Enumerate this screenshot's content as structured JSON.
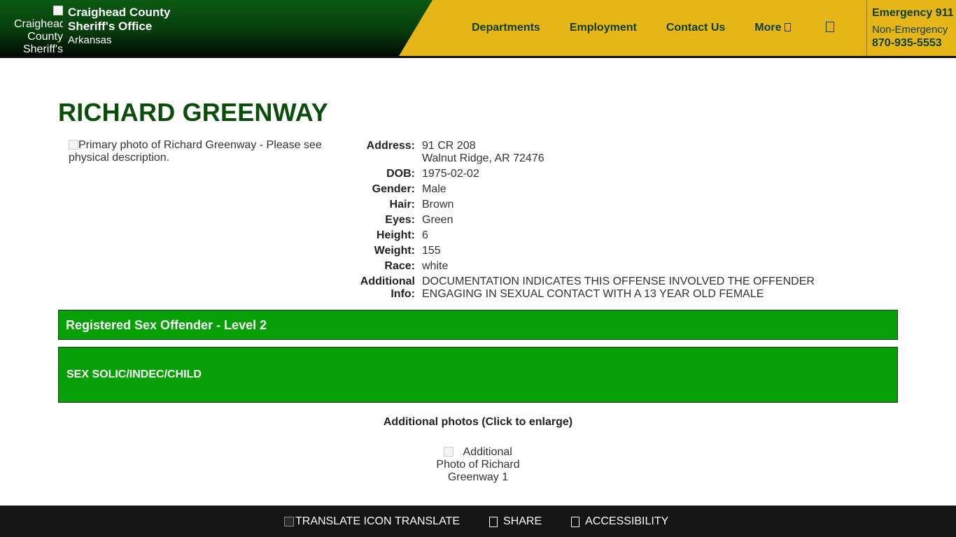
{
  "header": {
    "logo_alt": "Craighead County Sheriff's Office",
    "org_name": "Craighead County Sheriff's Office",
    "org_state": "Arkansas",
    "nav": [
      "Departments",
      "Employment",
      "Contact Us",
      "More"
    ],
    "emergency_label": "Emergency 911",
    "non_emergency_label": "Non-Emergency",
    "non_emergency_phone": "870-935-5553"
  },
  "offender": {
    "name": "RICHARD GREENWAY",
    "photo_alt": "Primary photo of Richard Greenway - Please see physical description.",
    "fields": {
      "address_label": "Address:",
      "address_line1": "91 CR 208",
      "address_line2": "Walnut Ridge, AR 72476",
      "dob_label": "DOB:",
      "dob": "1975-02-02",
      "gender_label": "Gender:",
      "gender": "Male",
      "hair_label": "Hair:",
      "hair": "Brown",
      "eyes_label": "Eyes:",
      "eyes": "Green",
      "height_label": "Height:",
      "height": "6",
      "weight_label": "Weight:",
      "weight": "155",
      "race_label": "Race:",
      "race": "white",
      "info_label_1": "Additional",
      "info_label_2": "Info:",
      "info_line1": "DOCUMENTATION INDICATES THIS OFFENSE INVOLVED THE OFFENDER",
      "info_line2": "ENGAGING IN SEXUAL CONTACT WITH A 13 YEAR OLD FEMALE"
    },
    "level": "Registered Sex Offender - Level 2",
    "offense": "SEX SOLIC/INDEC/CHILD",
    "additional_photos_heading": "Additional photos (Click to enlarge)",
    "additional_photo_alt": "Additional Photo of Richard Greenway 1"
  },
  "footer": {
    "translate_alt": "TRANSLATE ICON",
    "translate": "TRANSLATE",
    "share": "SHARE",
    "accessibility": "ACCESSIBILITY"
  },
  "colors": {
    "header_gold": "#e6b619",
    "brand_green": "#0b5a12",
    "title_green": "#0b4d0b",
    "band_green": "#05a005",
    "footer_bg": "#151515"
  },
  "icons": {
    "more": "chevron-down-icon",
    "search": "search-icon",
    "share": "share-icon",
    "accessibility": "accessibility-icon"
  }
}
